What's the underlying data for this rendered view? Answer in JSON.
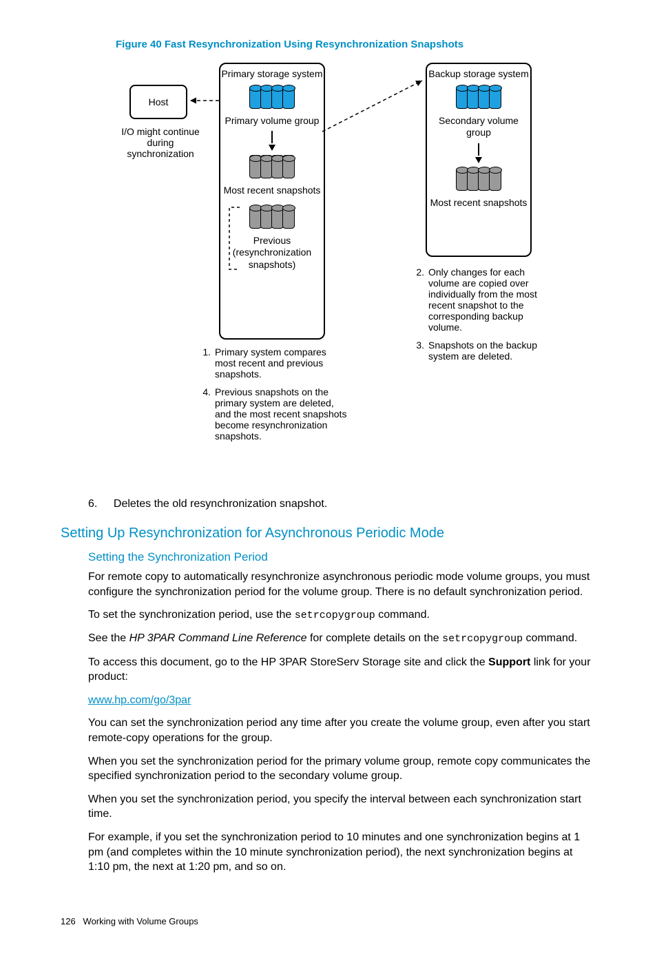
{
  "figure_title": "Figure 40 Fast Resynchronization Using Resynchronization Snapshots",
  "diagram": {
    "host": "Host",
    "host_caption": "I/O might continue during synchronization",
    "primary_title": "Primary storage system",
    "primary_vol": "Primary volume group",
    "most_recent": "Most recent snapshots",
    "previous": "Previous (resynchronization snapshots)",
    "backup_title": "Backup storage system",
    "secondary_vol": "Secondary volume group",
    "backup_recent": "Most recent snapshots",
    "note1": "Primary system compares most recent and previous snapshots.",
    "note4": "Previous snapshots on the primary system are deleted, and the most recent snapshots become resynchronization snapshots.",
    "note2": "Only changes for each volume are copied over individually from the most recent snapshot to the corresponding backup volume.",
    "note3": "Snapshots on the backup system are deleted."
  },
  "list6": "Deletes the old resynchronization snapshot.",
  "h2": "Setting Up Resynchronization for Asynchronous Periodic Mode",
  "h3": "Setting the Synchronization Period",
  "p1": "For remote copy to automatically resynchronize asynchronous periodic mode volume groups, you must configure the synchronization period for the volume group. There is no default synchronization period.",
  "p2a": "To set the synchronization period, use the ",
  "p2cmd": "setrcopygroup",
  "p2b": " command.",
  "p3a": "See the ",
  "p3i": "HP 3PAR Command Line Reference",
  "p3b": "  for complete details on the ",
  "p3cmd": "setrcopygroup",
  "p3c": " command.",
  "p4a": "To access this document, go to the HP 3PAR StoreServ Storage site and click the ",
  "p4bold": "Support",
  "p4b": " link for your product:",
  "link": "www.hp.com/go/3par",
  "p5": "You can set the synchronization period any time after you create the volume group, even after you start remote-copy operations for the group.",
  "p6": "When you set the synchronization period for the primary volume group, remote copy communicates the specified synchronization period to the secondary volume group.",
  "p7": "When you set the synchronization period, you specify the interval between each synchronization start time.",
  "p8": "For example, if you set the synchronization period to 10 minutes and one synchronization begins at 1 pm (and completes within the 10 minute synchronization period), the next synchronization begins at 1:10 pm, the next at 1:20 pm, and so on.",
  "footer_num": "126",
  "footer_text": "Working with Volume Groups"
}
